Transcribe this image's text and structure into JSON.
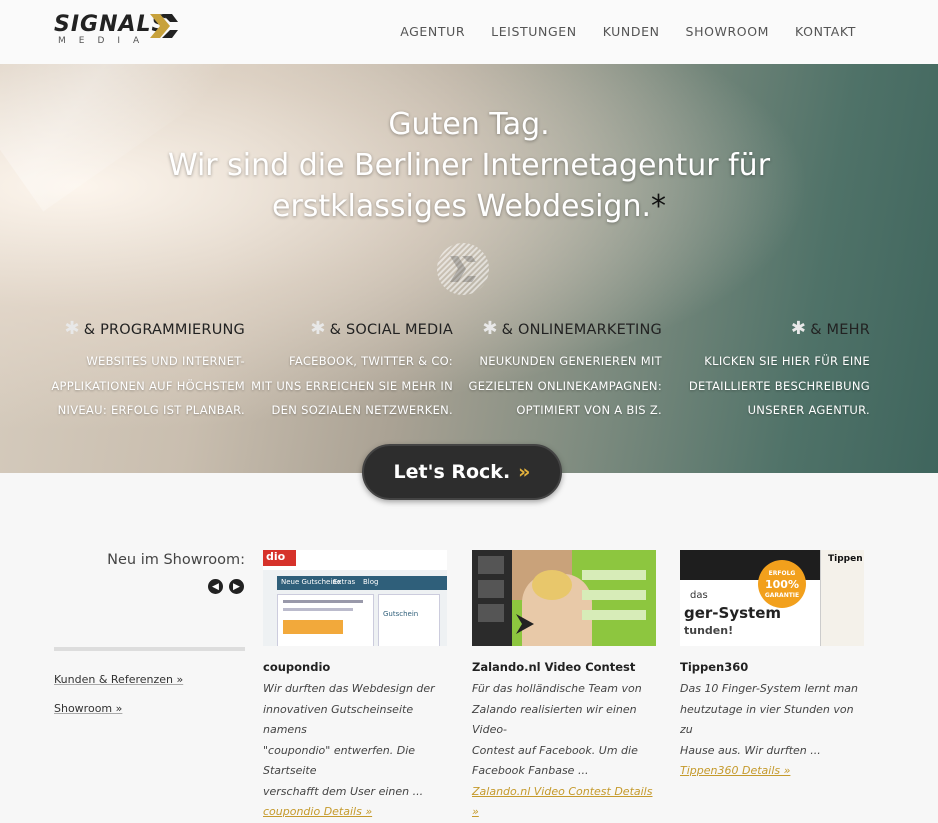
{
  "header": {
    "logo": {
      "name": "SIGNALS",
      "sub": "MEDIA"
    },
    "nav": [
      "AGENTUR",
      "LEISTUNGEN",
      "KUNDEN",
      "SHOWROOM",
      "KONTAKT"
    ]
  },
  "hero": {
    "line1": "Guten Tag.",
    "line2": "Wir sind die Berliner Internetagentur für",
    "line3": "erstklassiges Webdesign.",
    "asterisk": "*",
    "features": [
      {
        "title": "& PROGRAMMIERUNG",
        "lines": [
          "WEBSITES UND INTERNET-",
          "APPLIKATIONEN AUF HÖCHSTEM",
          "NIVEAU: ERFOLG IST PLANBAR."
        ]
      },
      {
        "title": "& SOCIAL MEDIA",
        "lines": [
          "FACEBOOK, TWITTER & CO:",
          "MIT UNS ERREICHEN SIE MEHR IN",
          "DEN SOZIALEN NETZWERKEN."
        ]
      },
      {
        "title": "& ONLINEMARKETING",
        "lines": [
          "NEUKUNDEN GENERIEREN MIT",
          "GEZIELTEN ONLINEKAMPAGNEN:",
          "OPTIMIERT VON A BIS Z."
        ]
      },
      {
        "title": "& MEHR",
        "lines": [
          "KLICKEN SIE HIER FÜR EINE",
          "DETAILLIERTE BESCHREIBUNG",
          "UNSERER AGENTUR."
        ]
      }
    ],
    "cta_label": "Let's Rock.",
    "cta_arrow": "»"
  },
  "showroom": {
    "label": "Neu im Showroom:",
    "links": [
      "Kunden & Referenzen »",
      "Showroom »"
    ],
    "cards": [
      {
        "title": "coupondio",
        "lines": [
          "Wir durften das Webdesign der",
          "innovativen Gutscheinseite namens",
          "\"coupondio\" entwerfen. Die Startseite",
          "verschafft dem User einen ..."
        ],
        "link": "coupondio Details »"
      },
      {
        "title": "Zalando.nl Video Contest",
        "lines": [
          "Für das holländische Team von",
          "Zalando realisierten wir einen Video-",
          "Contest auf Facebook. Um die",
          "Facebook Fanbase ..."
        ],
        "link": "Zalando.nl Video Contest Details »"
      },
      {
        "title": "Tippen360",
        "lines": [
          "Das 10 Finger-System lernt man",
          "heutzutage in vier Stunden von zu",
          "Hause aus. Wir durften ..."
        ],
        "link": "Tippen360 Details »"
      }
    ],
    "thumb_text": {
      "coupondio_logo": "dio",
      "tab1": "Neue Gutscheine",
      "tab2": "Extras",
      "tab3": "Blog",
      "promo": "Gutschein",
      "tippen_badge1": "ERFOLG",
      "tippen_badge2": "100%",
      "tippen_badge3": "GARANTIE",
      "tippen_heading": "ger-System",
      "tippen_sub": "tunden!",
      "tippen_das": "das",
      "tippen_brand": "Tippen"
    }
  },
  "colors": {
    "accent": "#e3b13c",
    "dark": "#2d2d2d",
    "link": "#c59a2c"
  }
}
